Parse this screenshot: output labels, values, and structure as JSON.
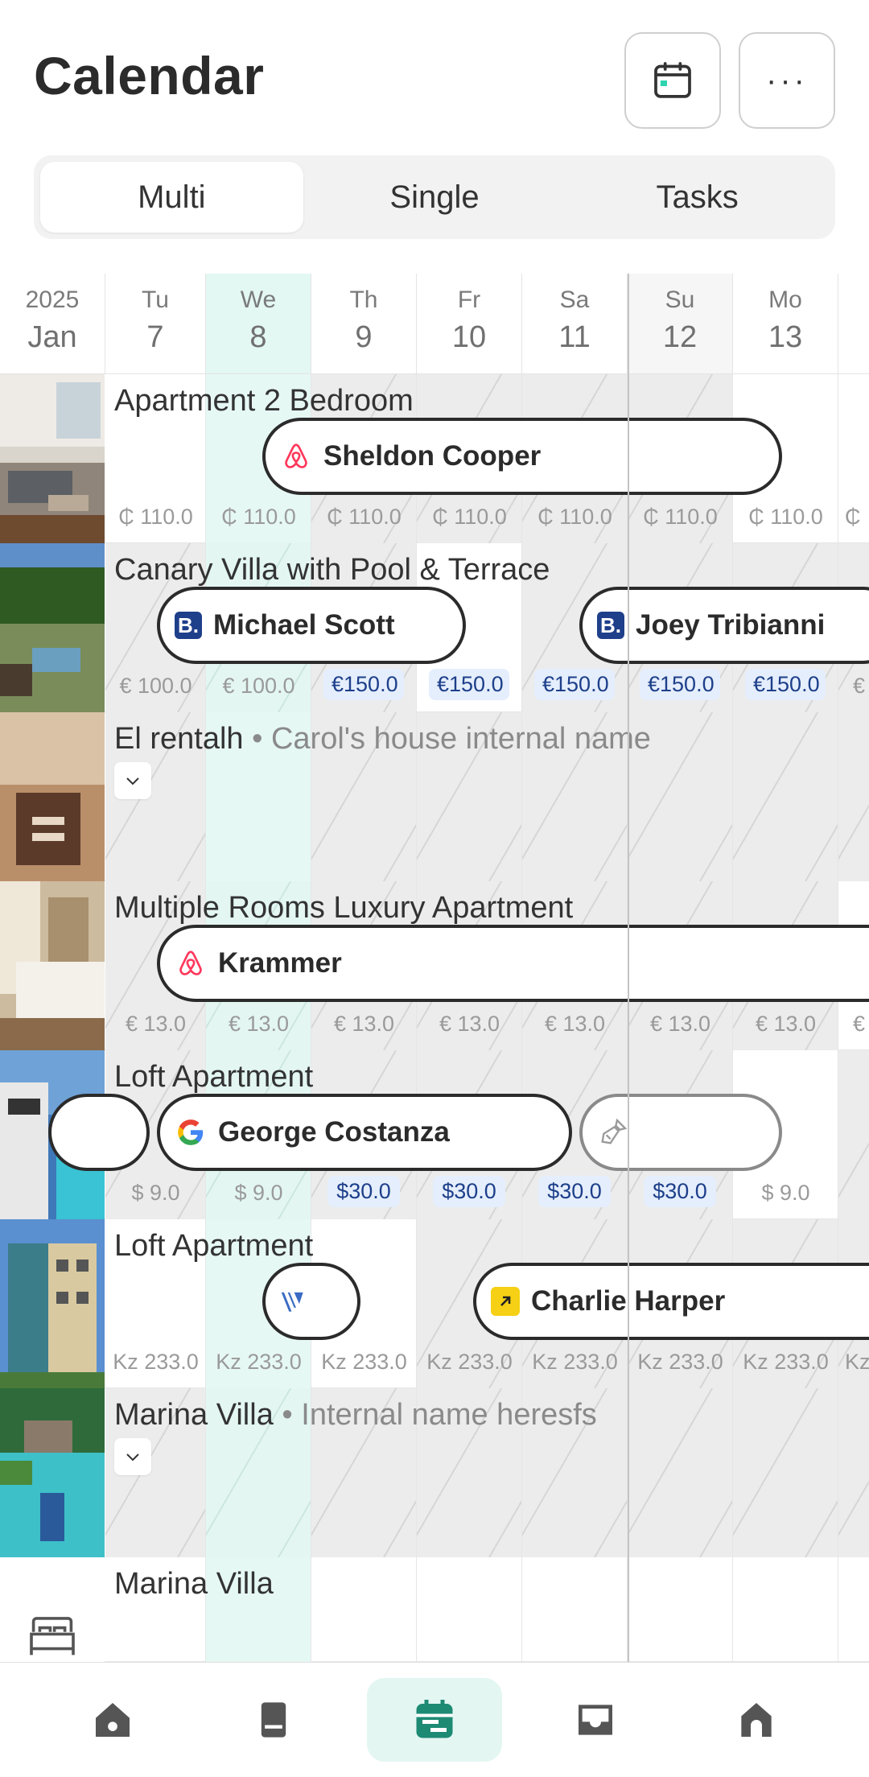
{
  "header": {
    "title": "Calendar",
    "calendar_icon": "calendar-icon",
    "more_label": "···"
  },
  "tabs": [
    {
      "label": "Multi",
      "active": true
    },
    {
      "label": "Single",
      "active": false
    },
    {
      "label": "Tasks",
      "active": false
    }
  ],
  "calendar": {
    "year": "2025",
    "month": "Jan",
    "days": [
      {
        "dow": "Tu",
        "num": "7"
      },
      {
        "dow": "We",
        "num": "8",
        "today": true
      },
      {
        "dow": "Th",
        "num": "9"
      },
      {
        "dow": "Fr",
        "num": "10"
      },
      {
        "dow": "Sa",
        "num": "11"
      },
      {
        "dow": "Su",
        "num": "12"
      },
      {
        "dow": "Mo",
        "num": "13"
      }
    ]
  },
  "listings": [
    {
      "title": "Apartment 2 Bedroom",
      "prices": [
        "₵ 110.0",
        "₵ 110.0",
        "₵ 110.0",
        "₵ 110.0",
        "₵ 110.0",
        "₵ 110.0",
        "₵ 110.0",
        "₵"
      ],
      "bookings": [
        {
          "guest": "Sheldon Cooper",
          "source": "airbnb-icon"
        }
      ]
    },
    {
      "title": "Canary Villa with Pool & Terrace",
      "prices": [
        "€ 100.0",
        "€ 100.0",
        "€150.0",
        "€150.0",
        "€150.0",
        "€150.0",
        "€150.0",
        "€"
      ],
      "bookings": [
        {
          "guest": "Michael Scott",
          "source": "booking-icon"
        },
        {
          "guest": "Joey Tribianni",
          "source": "booking-icon"
        }
      ]
    },
    {
      "title": "El rentalh",
      "internal_name": "• Carol's house internal name"
    },
    {
      "title": "Multiple Rooms Luxury Apartment",
      "prices": [
        "€ 13.0",
        "€ 13.0",
        "€ 13.0",
        "€ 13.0",
        "€ 13.0",
        "€ 13.0",
        "€ 13.0",
        "€"
      ],
      "bookings": [
        {
          "guest": "Krammer",
          "source": "airbnb-icon"
        }
      ]
    },
    {
      "title": "Loft Apartment",
      "prices": [
        "$ 9.0",
        "$ 9.0",
        "$30.0",
        "$30.0",
        "$30.0",
        "$30.0",
        "$ 9.0"
      ],
      "bookings": [
        {
          "guest": "George Costanza",
          "source": "google-icon"
        },
        {
          "guest": "",
          "source": "cleaning-icon"
        }
      ]
    },
    {
      "title": "Loft Apartment",
      "prices": [
        "Kz 233.0",
        "Kz 233.0",
        "Kz 233.0",
        "Kz 233.0",
        "Kz 233.0",
        "Kz 233.0",
        "Kz 233.0",
        "Kz"
      ],
      "bookings": [
        {
          "guest": "",
          "source": "vrbo-icon"
        },
        {
          "guest": "Charlie Harper",
          "source": "direct-icon"
        }
      ]
    },
    {
      "title": "Marina Villa",
      "internal_name": "• Internal name heresfs"
    },
    {
      "title": "Marina Villa"
    }
  ],
  "bottom_nav": [
    {
      "name": "home-icon",
      "active": false
    },
    {
      "name": "book-icon",
      "active": false
    },
    {
      "name": "calendar-icon",
      "active": true
    },
    {
      "name": "inbox-icon",
      "active": false
    },
    {
      "name": "property-icon",
      "active": false
    }
  ],
  "colors": {
    "accent": "#1d8a74",
    "today_bg": "#e3f6f2",
    "airbnb": "#ff385c",
    "booking": "#1e3f8a",
    "price_highlight": "#e5eefc"
  }
}
